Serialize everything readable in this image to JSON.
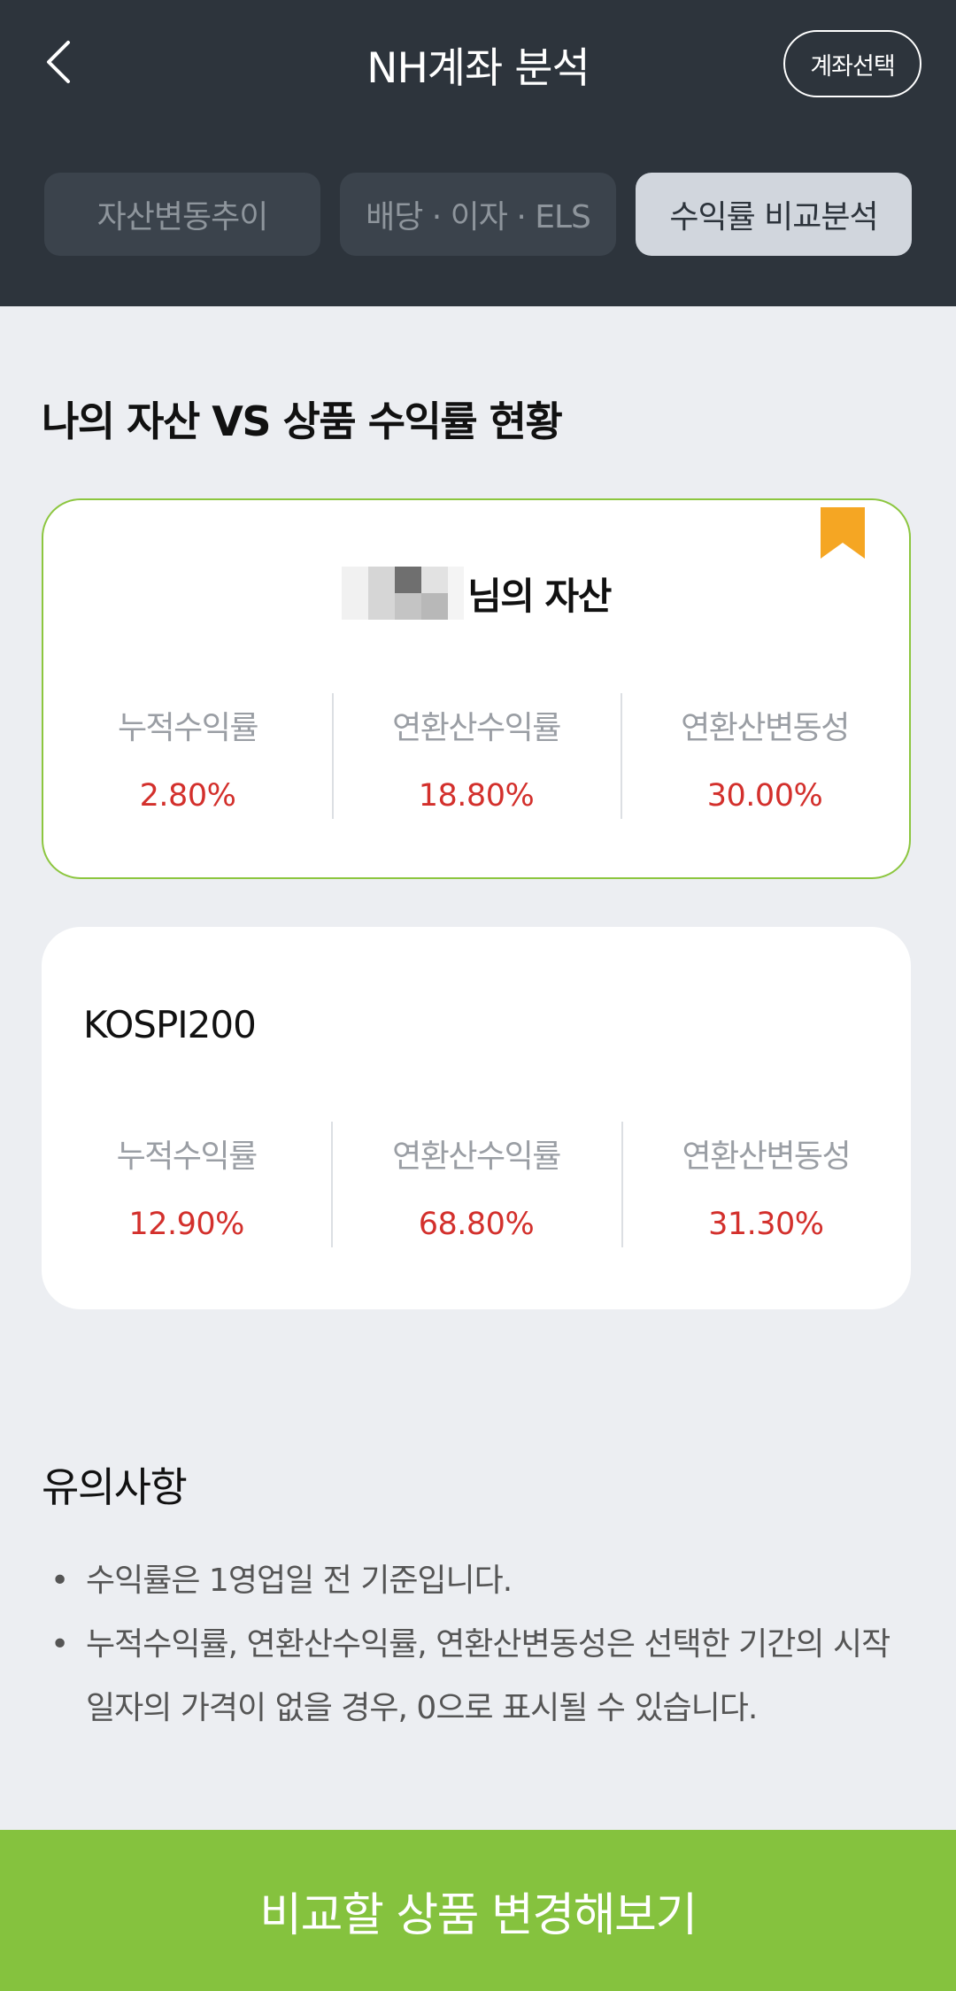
{
  "header": {
    "title": "NH계좌 분석",
    "account_select_label": "계좌선택",
    "tabs": [
      {
        "label": "자산변동추이",
        "active": false
      },
      {
        "label": "배당 · 이자 · ELS",
        "active": false
      },
      {
        "label": "수익률 비교분석",
        "active": true
      }
    ]
  },
  "section": {
    "title": "나의 자산 VS 상품 수익률 현황"
  },
  "my_asset": {
    "owner_suffix": "님의 자산",
    "metrics": [
      {
        "label": "누적수익률",
        "value": "2.80%"
      },
      {
        "label": "연환산수익률",
        "value": "18.80%"
      },
      {
        "label": "연환산변동성",
        "value": "30.00%"
      }
    ]
  },
  "index_product": {
    "name": "KOSPI200",
    "metrics": [
      {
        "label": "누적수익률",
        "value": "12.90%"
      },
      {
        "label": "연환산수익률",
        "value": "68.80%"
      },
      {
        "label": "연환산변동성",
        "value": "31.30%"
      }
    ]
  },
  "notice": {
    "title": "유의사항",
    "items": [
      "수익률은 1영업일 전 기준입니다.",
      "누적수익률, 연환산수익률, 연환산변동성은 선택한 기간의 시작일자의 가격이 없을 경우, 0으로 표시될 수 있습니다."
    ]
  },
  "cta": {
    "label": "비교할 상품 변경해보기"
  },
  "colors": {
    "header_bg": "#2d343c",
    "accent_green": "#85c23e",
    "card_border_green": "#8cc63f",
    "value_red": "#d3302c",
    "bookmark_orange": "#f5a623"
  },
  "icons": {
    "back": "chevron-left-icon",
    "bookmark": "bookmark-icon"
  }
}
